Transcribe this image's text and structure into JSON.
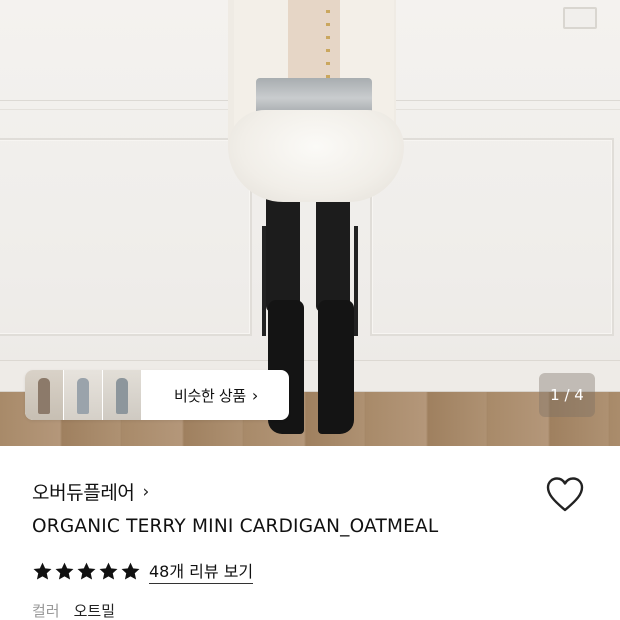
{
  "hero": {
    "similar_products_label": "비슷한 상품",
    "similar_products_chevron": "›",
    "page_counter": "1 / 4"
  },
  "product": {
    "brand": "오버듀플레어",
    "brand_chevron": "›",
    "name": "ORGANIC TERRY MINI CARDIGAN_OATMEAL",
    "rating_stars": 5,
    "review_link": "48개 리뷰 보기",
    "color_label": "컬러",
    "color_value": "오트밀"
  },
  "icons": {
    "wishlist": "heart-outline-icon",
    "star": "star-filled-icon",
    "chevron": "chevron-right-icon"
  },
  "colors": {
    "star": "#111111",
    "counter_bg": "rgba(120,110,100,0.38)"
  }
}
